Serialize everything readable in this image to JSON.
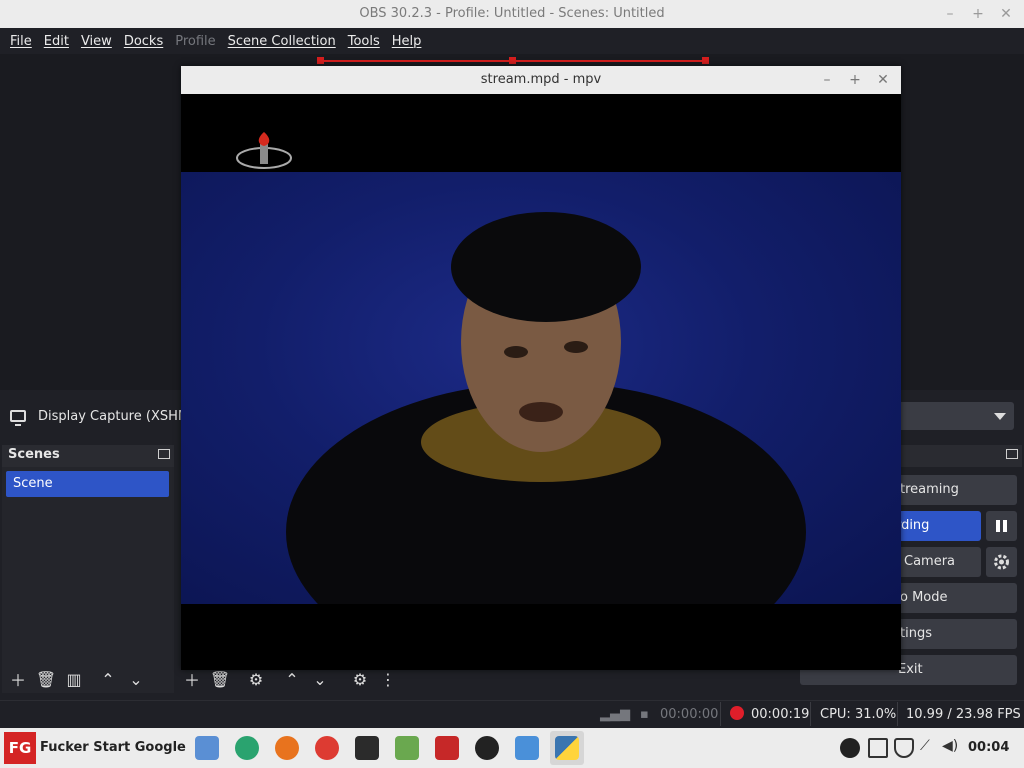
{
  "window": {
    "title": "OBS 30.2.3 - Profile: Untitled - Scenes: Untitled",
    "minimize": "–",
    "maximize": "+",
    "close": "✕"
  },
  "menu": {
    "file": "File",
    "edit": "Edit",
    "view": "View",
    "docks": "Docks",
    "profile": "Profile",
    "scene_collection": "Scene Collection",
    "tools": "Tools",
    "help": "Help"
  },
  "source": {
    "label": "Display Capture (XSHM)"
  },
  "scenes": {
    "title": "Scenes",
    "items": [
      "Scene"
    ]
  },
  "controls": {
    "start_streaming": "treaming",
    "stop_recording": "ording",
    "virtual_camera": "Camera",
    "studio_mode": "o Mode",
    "settings": "tings",
    "exit": "Exit"
  },
  "status": {
    "stream_time": "00:00:00",
    "rec_time": "00:00:19",
    "cpu": "CPU: 31.0%",
    "fps": "10.99 / 23.98 FPS"
  },
  "mpv": {
    "title": "stream.mpd - mpv",
    "minimize": "–",
    "maximize": "+",
    "close": "✕"
  },
  "taskbar": {
    "start_label": "Fucker Start Google",
    "start_badge": "FG",
    "clock": "00:04",
    "apps": [
      "file-manager",
      "edge-dev",
      "firefox",
      "chrome",
      "terminal",
      "updater",
      "tex-app",
      "obs",
      "kde-app",
      "python"
    ]
  },
  "colors": {
    "accent": "#2e55c7",
    "record_red": "#e01e2a",
    "start_red": "#d42424"
  }
}
